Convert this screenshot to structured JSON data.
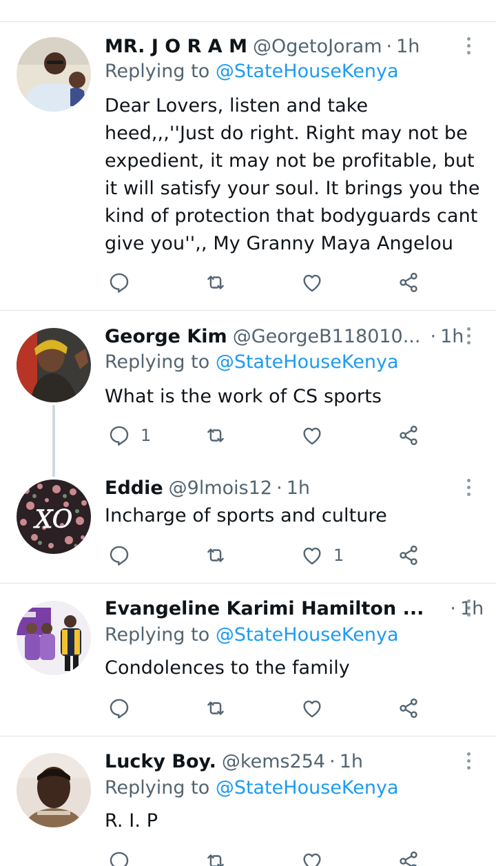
{
  "tweets": [
    {
      "name": "MR. J O R A M",
      "handle": "@OgetoJoram",
      "time": "1h",
      "replying_prefix": "Replying to",
      "replying_to": "@StateHouseKenya",
      "text_lines": [
        "Dear Lovers, listen and take",
        "heed,,,''Just do right. Right may not be",
        "expedient, it may not be profitable, but",
        "it will satisfy your soul. It brings you the",
        "kind of protection that bodyguards cant",
        "give you'',, My Granny Maya Angelou"
      ],
      "reply_count": "",
      "retweet_count": "",
      "like_count": ""
    },
    {
      "name": "George Kim",
      "handle": "@GeorgeB118010...",
      "time": "1h",
      "replying_prefix": "Replying to",
      "replying_to": "@StateHouseKenya",
      "text_lines": [
        "What is the work of CS sports"
      ],
      "reply_count": "1",
      "retweet_count": "",
      "like_count": ""
    },
    {
      "name": "Eddie",
      "handle": "@9lmois12",
      "time": "1h",
      "text_lines": [
        "Incharge of sports and culture"
      ],
      "reply_count": "",
      "retweet_count": "",
      "like_count": "1"
    },
    {
      "name": "Evangeline Karimi Hamilton ...",
      "handle": "",
      "time": "1h",
      "replying_prefix": "Replying to",
      "replying_to": "@StateHouseKenya",
      "text_lines": [
        "Condolences to the family"
      ],
      "reply_count": "",
      "retweet_count": "",
      "like_count": ""
    },
    {
      "name": "Lucky Boy.",
      "handle": "@kems254",
      "time": "1h",
      "replying_prefix": "Replying to",
      "replying_to": "@StateHouseKenya",
      "text_lines": [
        "R. I. P"
      ],
      "reply_count": "",
      "retweet_count": "",
      "like_count": ""
    }
  ],
  "icons": {
    "reply": "reply-icon",
    "retweet": "retweet-icon",
    "like": "heart-icon",
    "share": "share-icon",
    "more": "more-vertical-icon"
  },
  "colors": {
    "text": "#0f1419",
    "secondary": "#536471",
    "link": "#1d9bf0",
    "icon": "#536471",
    "divider": "#dfe3e6"
  }
}
